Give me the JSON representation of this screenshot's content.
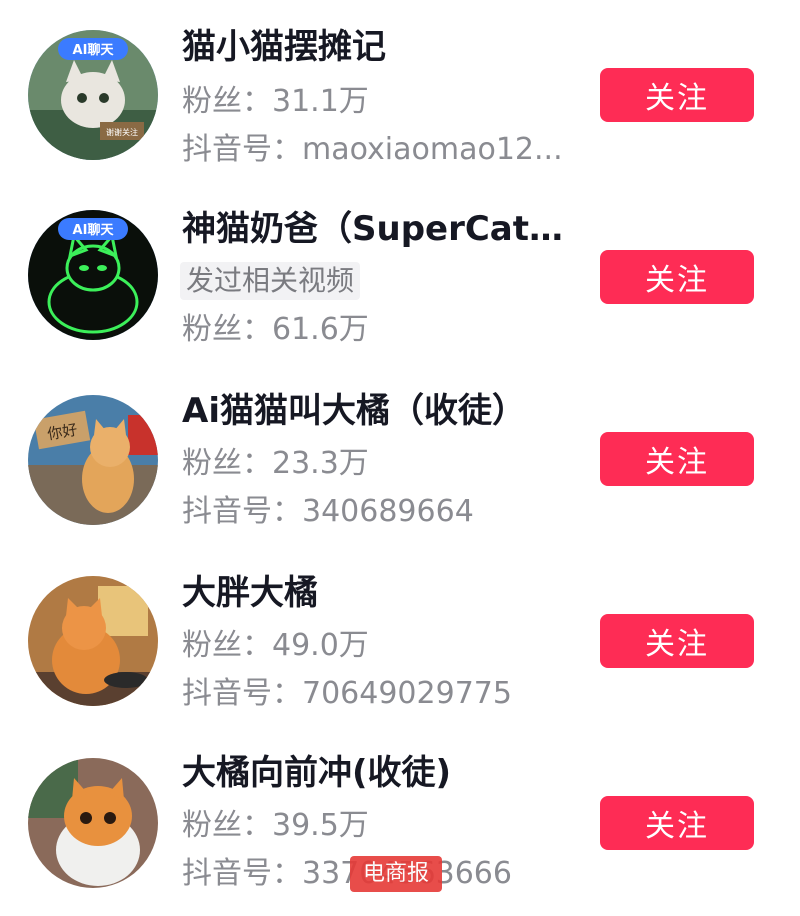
{
  "users": [
    {
      "name": "猫小猫摆摊记",
      "fans": "粉丝：31.1万",
      "id_line": "抖音号：maoxiaomao12...",
      "avatar_badge": "AI聊天",
      "avatar_sign": "谢谢关注",
      "follow_label": "关注"
    },
    {
      "name": "神猫奶爸（SuperCatP...",
      "tag": "发过相关视频",
      "fans": "粉丝：61.6万",
      "avatar_badge": "AI聊天",
      "follow_label": "关注"
    },
    {
      "name": "Ai猫猫叫大橘（收徒）",
      "fans": "粉丝：23.3万",
      "id_line": "抖音号：340689664",
      "avatar_sign": "你好",
      "follow_label": "关注"
    },
    {
      "name": "大胖大橘",
      "fans": "粉丝：49.0万",
      "id_line": "抖音号：70649029775",
      "follow_label": "关注"
    },
    {
      "name": "大橘向前冲(收徒)",
      "fans": "粉丝：39.5万",
      "id_line": "抖音号：33704563666",
      "follow_label": "关注"
    }
  ],
  "watermark": "电商报",
  "colors": {
    "follow_button": "#fe2c55",
    "name_text": "#161823",
    "meta_text": "#8a8b91"
  }
}
